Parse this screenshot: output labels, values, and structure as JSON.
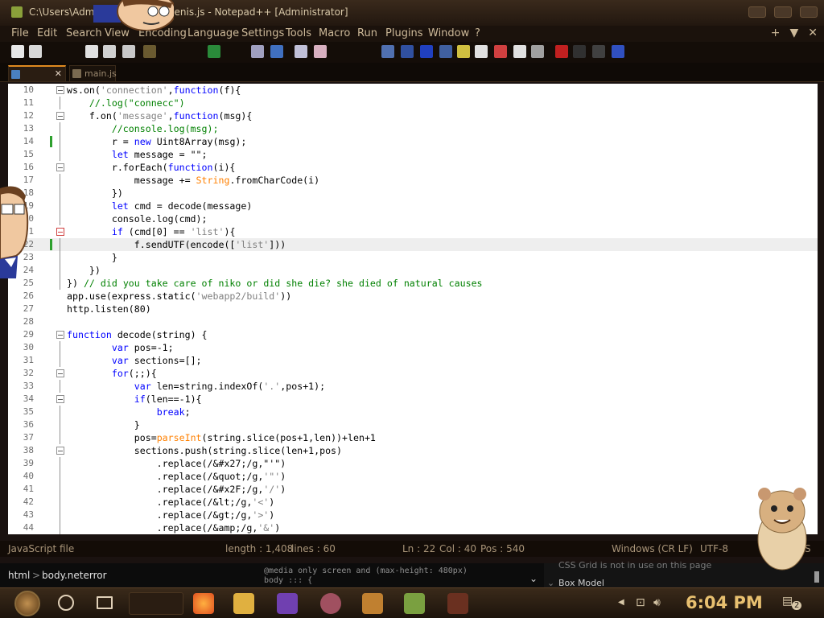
{
  "window": {
    "title": "C:\\Users\\Admi... \\New folder\\penis.js - Notepad++ [Administrator]"
  },
  "menu": [
    "File",
    "Edit",
    "Search",
    "View",
    "Encoding",
    "Language",
    "Settings",
    "Tools",
    "Macro",
    "Run",
    "Plugins",
    "Window",
    "?"
  ],
  "menu_right": {
    "plus": "+",
    "down": "▼",
    "close": "✕"
  },
  "tabs": [
    {
      "label": "",
      "close": "✕"
    },
    {
      "label": "main.js"
    }
  ],
  "code_lines": [
    {
      "n": "10",
      "text": "ws.on('connection',function(f){"
    },
    {
      "n": "11",
      "text": "    //.log(\"connecc\")"
    },
    {
      "n": "12",
      "text": "    f.on('message',function(msg){"
    },
    {
      "n": "13",
      "text": "        //console.log(msg);"
    },
    {
      "n": "14",
      "text": "        r = new Uint8Array(msg);"
    },
    {
      "n": "15",
      "text": "        let message = \"\";"
    },
    {
      "n": "16",
      "text": "        r.forEach(function(i){"
    },
    {
      "n": "17",
      "text": "            message += String.fromCharCode(i)"
    },
    {
      "n": "18",
      "text": "        })"
    },
    {
      "n": "19",
      "text": "        let cmd = decode(message)"
    },
    {
      "n": "20",
      "text": "        console.log(cmd);"
    },
    {
      "n": "21",
      "text": "        if (cmd[0] == 'list'){"
    },
    {
      "n": "22",
      "text": "            f.sendUTF(encode(['list']))"
    },
    {
      "n": "23",
      "text": "        }"
    },
    {
      "n": "24",
      "text": "    })"
    },
    {
      "n": "25",
      "text": "}) // did you take care of niko or did she die? she died of natural causes"
    },
    {
      "n": "26",
      "text": "app.use(express.static('webapp2/build'))"
    },
    {
      "n": "27",
      "text": "http.listen(80)"
    },
    {
      "n": "28",
      "text": ""
    },
    {
      "n": "29",
      "text": "function decode(string) {"
    },
    {
      "n": "30",
      "text": "        var pos=-1;"
    },
    {
      "n": "31",
      "text": "        var sections=[];"
    },
    {
      "n": "32",
      "text": "        for(;;){"
    },
    {
      "n": "33",
      "text": "            var len=string.indexOf('.',pos+1);"
    },
    {
      "n": "34",
      "text": "            if(len==-1){"
    },
    {
      "n": "35",
      "text": "                break;"
    },
    {
      "n": "36",
      "text": "            }"
    },
    {
      "n": "37",
      "text": "            pos=parseInt(string.slice(pos+1,len))+len+1"
    },
    {
      "n": "38",
      "text": "            sections.push(string.slice(len+1,pos)"
    },
    {
      "n": "39",
      "text": "                .replace(/&#x27;/g,\"'\")"
    },
    {
      "n": "40",
      "text": "                .replace(/&quot;/g,'\"')"
    },
    {
      "n": "41",
      "text": "                .replace(/&#x2F;/g,'/')"
    },
    {
      "n": "42",
      "text": "                .replace(/&lt;/g,'<')"
    },
    {
      "n": "43",
      "text": "                .replace(/&gt;/g,'>')"
    },
    {
      "n": "44",
      "text": "                .replace(/&amp;/g,'&')"
    }
  ],
  "status": {
    "file_type": "JavaScript file",
    "length": "length : 1,408",
    "lines": "lines : 60",
    "ln": "Ln : 22",
    "col": "Col : 40",
    "pos": "Pos : 540",
    "eol": "Windows (CR LF)",
    "encoding": "UTF-8",
    "mode": "S"
  },
  "devtools": {
    "crumb_html": "html",
    "crumb_sep": ">",
    "crumb_body": "body.neterror",
    "css_snippet": "@media only screen and (max-height: 480px)\nbody ::: {",
    "grid_notice": "CSS Grid is not in use on this page",
    "box_model": "Box Model"
  },
  "taskbar": {
    "time": "6:04 PM",
    "notification_count": "2"
  },
  "colors": {
    "keyword": "#0000ff",
    "string": "#808080",
    "comment": "#008000",
    "number": "#ff8000",
    "clock": "#e8c070"
  }
}
